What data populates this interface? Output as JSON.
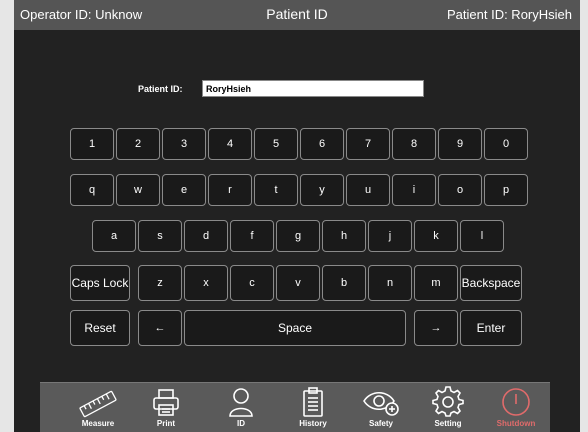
{
  "titlebar": {
    "operator": "Operator ID: Unknow",
    "title": "Patient ID",
    "patient": "Patient ID: RoryHsieh"
  },
  "form": {
    "label": "Patient ID:",
    "value": "RoryHsieh"
  },
  "keyboard": {
    "row1": [
      "1",
      "2",
      "3",
      "4",
      "5",
      "6",
      "7",
      "8",
      "9",
      "0"
    ],
    "row2": [
      "q",
      "w",
      "e",
      "r",
      "t",
      "y",
      "u",
      "i",
      "o",
      "p"
    ],
    "row3": [
      "a",
      "s",
      "d",
      "f",
      "g",
      "h",
      "j",
      "k",
      "l"
    ],
    "row4": [
      "Caps Lock",
      "z",
      "x",
      "c",
      "v",
      "b",
      "n",
      "m",
      "Backspace"
    ],
    "row5": [
      "Reset",
      "←",
      "Space",
      "→",
      "Enter"
    ]
  },
  "toolbar": {
    "items": [
      {
        "label": "Measure",
        "icon": "ruler-icon"
      },
      {
        "label": "Print",
        "icon": "printer-icon"
      },
      {
        "label": "ID",
        "icon": "person-icon"
      },
      {
        "label": "History",
        "icon": "clipboard-icon"
      },
      {
        "label": "Safety",
        "icon": "eye-shield-icon"
      },
      {
        "label": "Setting",
        "icon": "gear-icon"
      },
      {
        "label": "Shutdown",
        "icon": "power-icon"
      }
    ]
  },
  "colors": {
    "background": "#222222",
    "titlebar": "#555555",
    "toolbar": "#5a5a5a",
    "shutdown": "#e06b6b"
  }
}
